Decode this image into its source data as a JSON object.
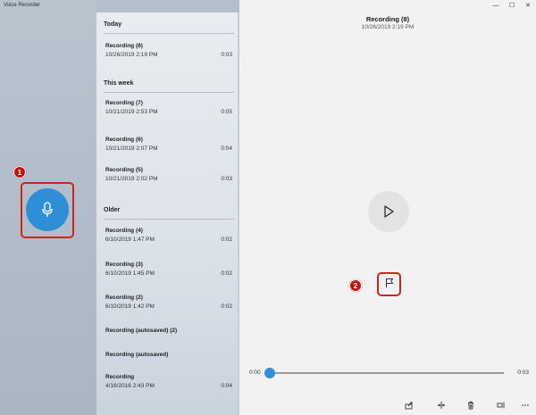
{
  "app": {
    "title": "Voice Recorder"
  },
  "window_controls": {
    "minimize": "—",
    "maximize": "☐",
    "close": "✕"
  },
  "record_button": {
    "icon": "microphone-icon",
    "color": "#2f8fd6"
  },
  "callouts": [
    {
      "number": "1"
    },
    {
      "number": "2"
    }
  ],
  "list": {
    "groups": [
      {
        "header": "Today",
        "items": [
          {
            "name": "Recording (8)",
            "date": "10/26/2019 2:19 PM",
            "duration": "0:03"
          }
        ]
      },
      {
        "header": "This week",
        "items": [
          {
            "name": "Recording (7)",
            "date": "10/21/2019 2:53 PM",
            "duration": "0:05"
          },
          {
            "name": "Recording (6)",
            "date": "10/21/2019 2:07 PM",
            "duration": "0:04"
          },
          {
            "name": "Recording (5)",
            "date": "10/21/2019 2:02 PM",
            "duration": "0:03"
          }
        ]
      },
      {
        "header": "Older",
        "items": [
          {
            "name": "Recording (4)",
            "date": "6/10/2019 1:47 PM",
            "duration": "0:02"
          },
          {
            "name": "Recording (3)",
            "date": "6/10/2019 1:45 PM",
            "duration": "0:02"
          },
          {
            "name": "Recording (2)",
            "date": "6/10/2019 1:42 PM",
            "duration": "0:02"
          },
          {
            "name": "Recording (autosaved) (2)",
            "date": "",
            "duration": ""
          },
          {
            "name": "Recording (autosaved)",
            "date": "",
            "duration": ""
          },
          {
            "name": "Recording",
            "date": "4/16/2016 2:43 PM",
            "duration": "0:04"
          }
        ]
      }
    ]
  },
  "detail": {
    "title": "Recording (8)",
    "date": "10/26/2019 2:19 PM",
    "play_icon": "play-icon",
    "flag_icon": "flag-icon",
    "time_start": "0:00",
    "time_end": "0:03",
    "progress_fraction": 0.0,
    "accent": "#2f8fd6"
  },
  "toolbar": {
    "icons": [
      "share-icon",
      "trim-icon",
      "delete-icon",
      "rename-icon",
      "more-icon"
    ]
  }
}
